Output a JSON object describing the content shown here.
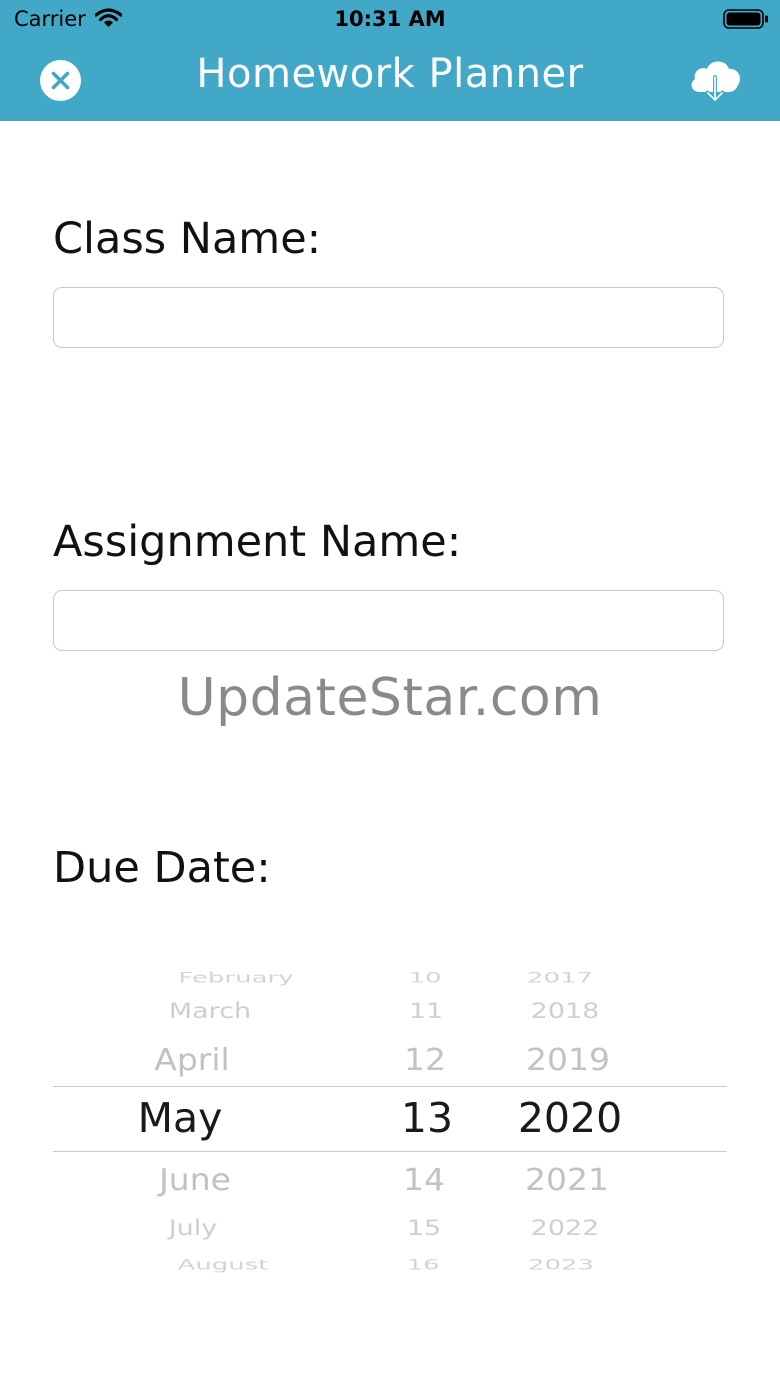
{
  "status_bar": {
    "carrier": "Carrier",
    "time": "10:31 AM"
  },
  "nav_bar": {
    "title": "Homework Planner",
    "left_icon": "close-circle-icon",
    "right_icon": "cloud-download-icon",
    "background_color": "#41a9c7"
  },
  "form": {
    "class_name": {
      "label": "Class Name:",
      "value": "",
      "placeholder": ""
    },
    "assignment_name": {
      "label": "Assignment Name:",
      "value": "",
      "placeholder": ""
    },
    "due_date": {
      "label": "Due Date:"
    }
  },
  "watermark": "UpdateStar.com",
  "date_picker": {
    "month": {
      "items": [
        "February",
        "March",
        "April",
        "May",
        "June",
        "July",
        "August"
      ],
      "selected": "May"
    },
    "day": {
      "items": [
        "10",
        "11",
        "12",
        "13",
        "14",
        "15",
        "16"
      ],
      "selected": "13"
    },
    "year": {
      "items": [
        "2017",
        "2018",
        "2019",
        "2020",
        "2021",
        "2022",
        "2023"
      ],
      "selected": "2020"
    }
  }
}
